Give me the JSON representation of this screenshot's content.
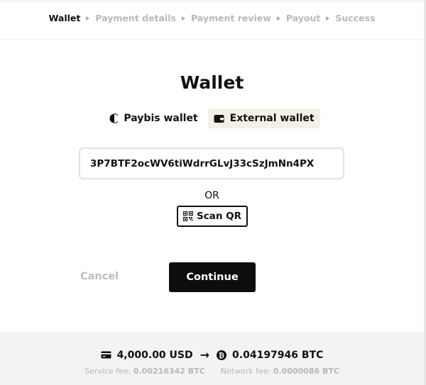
{
  "steps": [
    "Wallet",
    "Payment details",
    "Payment review",
    "Payout",
    "Success"
  ],
  "title": "Wallet",
  "wallet_tabs": {
    "paybis": "Paybis wallet",
    "external": "External wallet",
    "selected": "External wallet"
  },
  "address_input": {
    "value": "3P7BTF2ocWV6tiWdrrGLvJ33cSzJmNn4PX"
  },
  "or_text": "OR",
  "scan_qr_label": "Scan QR",
  "cancel_label": "Cancel",
  "continue_label": "Continue",
  "summary": {
    "pay_amount": "4,000.00 USD",
    "receive_amount": "0.04197946 BTC",
    "service_fee_label": "Service fee:",
    "service_fee_value": "0.00216342 BTC",
    "network_fee_label": "Network fee:",
    "network_fee_value": "0.0000086 BTC"
  },
  "icons": {
    "paybis": "paybis-logo-icon",
    "external_wallet": "wallet-icon",
    "qr": "qr-code-icon",
    "card": "card-icon",
    "arrow": "arrow-right-icon",
    "bitcoin": "bitcoin-icon"
  },
  "colors": {
    "primary": "#0d0d0d",
    "selected_tab_bg": "#f3f1e7",
    "muted_text": "#b9b9b9",
    "footer_bg": "#f3f3f3"
  }
}
